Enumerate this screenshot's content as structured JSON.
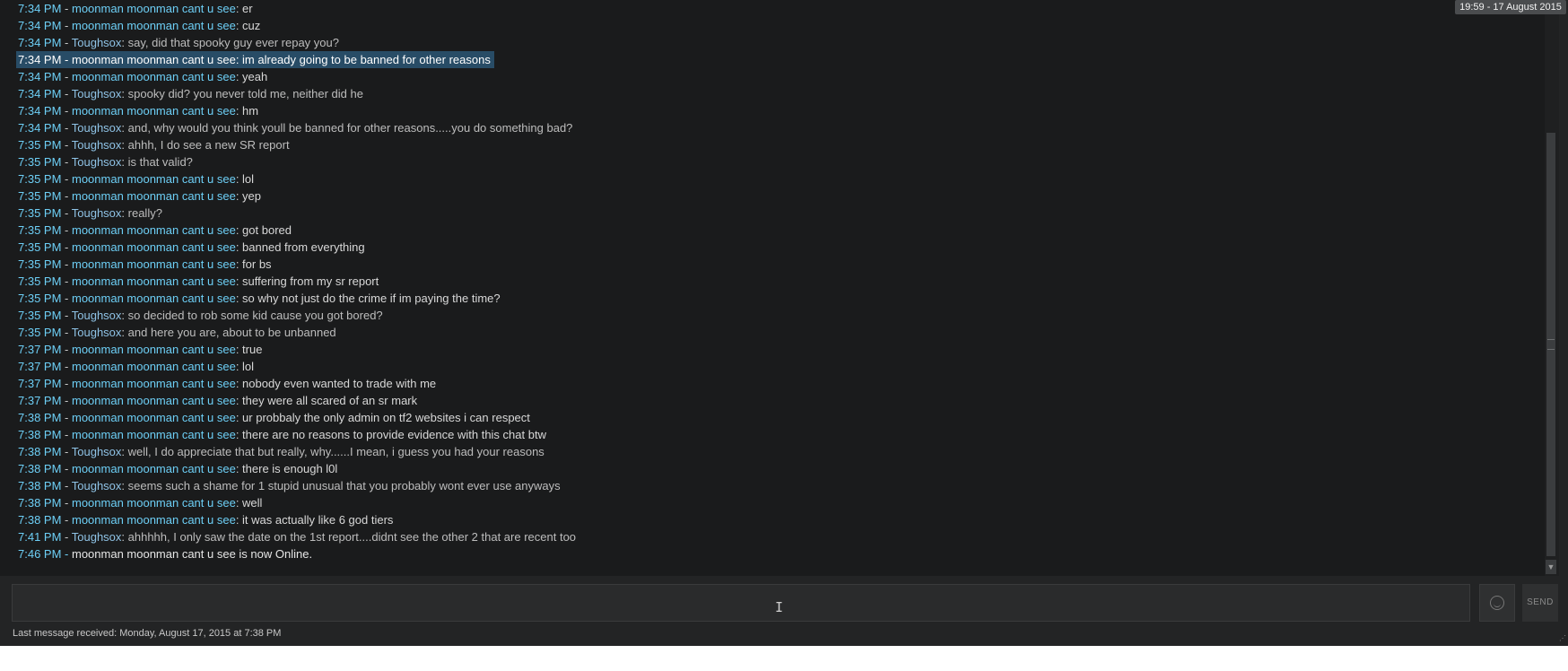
{
  "date_badge": "19:59 - 17 August 2015",
  "messages": [
    {
      "time": "7:34 PM",
      "name": "moonman moonman cant u see",
      "text": "er",
      "who": "mm"
    },
    {
      "time": "7:34 PM",
      "name": "moonman moonman cant u see",
      "text": "cuz",
      "who": "mm"
    },
    {
      "time": "7:34 PM",
      "name": "Toughsox",
      "text": "say, did that spooky guy ever repay you?",
      "who": "ts"
    },
    {
      "time": "7:34 PM",
      "name": "moonman moonman cant u see",
      "text": "im already going to be banned for other reasons",
      "who": "mm",
      "selected": true
    },
    {
      "time": "7:34 PM",
      "name": "moonman moonman cant u see",
      "text": "yeah",
      "who": "mm"
    },
    {
      "time": "7:34 PM",
      "name": "Toughsox",
      "text": "spooky did?  you never told me, neither did he",
      "who": "ts"
    },
    {
      "time": "7:34 PM",
      "name": "moonman moonman cant u see",
      "text": "hm",
      "who": "mm"
    },
    {
      "time": "7:34 PM",
      "name": "Toughsox",
      "text": "and, why would you think youll be banned for other reasons.....you do something bad?",
      "who": "ts"
    },
    {
      "time": "7:35 PM",
      "name": "Toughsox",
      "text": "ahhh, I do see a new SR report",
      "who": "ts"
    },
    {
      "time": "7:35 PM",
      "name": "Toughsox",
      "text": "is that valid?",
      "who": "ts"
    },
    {
      "time": "7:35 PM",
      "name": "moonman moonman cant u see",
      "text": "lol",
      "who": "mm"
    },
    {
      "time": "7:35 PM",
      "name": "moonman moonman cant u see",
      "text": "yep",
      "who": "mm"
    },
    {
      "time": "7:35 PM",
      "name": "Toughsox",
      "text": "really?",
      "who": "ts"
    },
    {
      "time": "7:35 PM",
      "name": "moonman moonman cant u see",
      "text": "got bored",
      "who": "mm"
    },
    {
      "time": "7:35 PM",
      "name": "moonman moonman cant u see",
      "text": "banned from everything",
      "who": "mm"
    },
    {
      "time": "7:35 PM",
      "name": "moonman moonman cant u see",
      "text": "for bs",
      "who": "mm"
    },
    {
      "time": "7:35 PM",
      "name": "moonman moonman cant u see",
      "text": "suffering from my sr report",
      "who": "mm"
    },
    {
      "time": "7:35 PM",
      "name": "moonman moonman cant u see",
      "text": "so why not just do the crime if im paying the time?",
      "who": "mm"
    },
    {
      "time": "7:35 PM",
      "name": "Toughsox",
      "text": "so decided to rob some kid cause you got bored?",
      "who": "ts"
    },
    {
      "time": "7:35 PM",
      "name": "Toughsox",
      "text": "and here you are, about to be unbanned",
      "who": "ts"
    },
    {
      "time": "7:37 PM",
      "name": "moonman moonman cant u see",
      "text": "true",
      "who": "mm"
    },
    {
      "time": "7:37 PM",
      "name": "moonman moonman cant u see",
      "text": "lol",
      "who": "mm"
    },
    {
      "time": "7:37 PM",
      "name": "moonman moonman cant u see",
      "text": "nobody even wanted to trade with me",
      "who": "mm"
    },
    {
      "time": "7:37 PM",
      "name": "moonman moonman cant u see",
      "text": "they were all scared of an sr mark",
      "who": "mm"
    },
    {
      "time": "7:38 PM",
      "name": "moonman moonman cant u see",
      "text": "ur probbaly the only admin on tf2 websites i can respect",
      "who": "mm"
    },
    {
      "time": "7:38 PM",
      "name": "moonman moonman cant u see",
      "text": "there are no reasons to provide evidence with this chat btw",
      "who": "mm"
    },
    {
      "time": "7:38 PM",
      "name": "Toughsox",
      "text": "well, I do appreciate that but really, why......I mean, i guess you had your reasons",
      "who": "ts"
    },
    {
      "time": "7:38 PM",
      "name": "moonman moonman cant u see",
      "text": "there is enough l0l",
      "who": "mm"
    },
    {
      "time": "7:38 PM",
      "name": "Toughsox",
      "text": "seems such a shame for 1 stupid unusual that you probably wont ever use anyways",
      "who": "ts"
    },
    {
      "time": "7:38 PM",
      "name": "moonman moonman cant u see",
      "text": "well",
      "who": "mm"
    },
    {
      "time": "7:38 PM",
      "name": "moonman moonman cant u see",
      "text": "it was actually like 6 god tiers",
      "who": "mm"
    },
    {
      "time": "7:41 PM",
      "name": "Toughsox",
      "text": "ahhhhh, I only saw the date on the 1st report....didnt see the other 2 that are recent too",
      "who": "ts"
    }
  ],
  "status_line": {
    "time": "7:46 PM",
    "text": "moonman moonman cant u see is now Online."
  },
  "input": {
    "value": "",
    "placeholder": ""
  },
  "send_label": "SEND",
  "footer": "Last message received: Monday, August 17, 2015 at 7:38 PM",
  "icons": {
    "emoji": "emoticon-icon",
    "scroll_down": "scroll-down-arrow-icon",
    "resize": "resize-grip-icon"
  },
  "colors": {
    "background": "#1a1b1c",
    "timestamp": "#6dcff6",
    "highlight": "#284c66"
  }
}
